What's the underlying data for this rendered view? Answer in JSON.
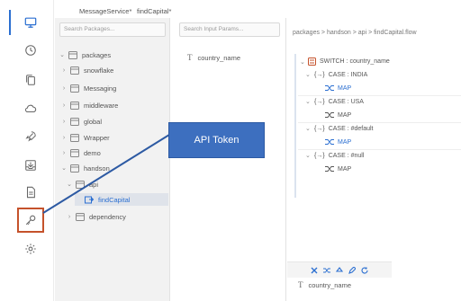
{
  "tabs": [
    {
      "label": "MessageService*"
    },
    {
      "label": "findCapital*"
    }
  ],
  "packages": {
    "search_placeholder": "Search Packages...",
    "root_label": "packages",
    "items": [
      {
        "label": "snowflake",
        "chev": "›"
      },
      {
        "label": "Messaging",
        "chev": "›"
      },
      {
        "label": "middleware",
        "chev": "›"
      },
      {
        "label": "global",
        "chev": "›"
      },
      {
        "label": "Wrapper",
        "chev": "›"
      },
      {
        "label": "demo",
        "chev": "›"
      },
      {
        "label": "handson",
        "chev": "⌄"
      },
      {
        "label": "api",
        "chev": "⌄"
      },
      {
        "label": "findCapital",
        "chev": ""
      },
      {
        "label": "dependency",
        "chev": "›"
      }
    ]
  },
  "inputs": {
    "search_placeholder": "Search Input Params...",
    "params": [
      {
        "type_glyph": "T",
        "name": "country_name"
      }
    ]
  },
  "flow": {
    "breadcrumb": "packages > handson > api > findCapital.flow",
    "switch_label": "SWITCH : country_name",
    "cases": [
      {
        "label": "CASE : INDIA",
        "map": "MAP",
        "map_active": true
      },
      {
        "label": "CASE : USA",
        "map": "MAP",
        "map_active": false
      },
      {
        "label": "CASE : #default",
        "map": "MAP",
        "map_active": true
      },
      {
        "label": "CASE : #null",
        "map": "MAP",
        "map_active": false
      }
    ],
    "output": {
      "type_glyph": "T",
      "name": "country_name"
    }
  },
  "callout": {
    "label": "API Token"
  },
  "colors": {
    "accent": "#2b6fd1",
    "highlight_border": "#c5522b",
    "callout_bg": "#3d6fbf"
  }
}
